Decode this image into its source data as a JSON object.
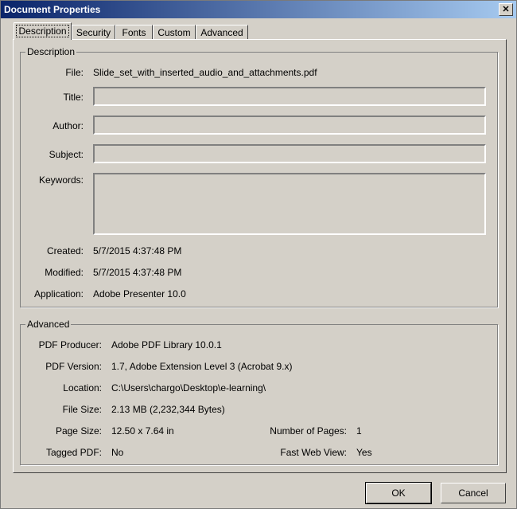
{
  "window": {
    "title": "Document Properties",
    "close_glyph": "✕"
  },
  "tabs": [
    {
      "label": "Description"
    },
    {
      "label": "Security"
    },
    {
      "label": "Fonts"
    },
    {
      "label": "Custom"
    },
    {
      "label": "Advanced"
    }
  ],
  "description": {
    "group_title": "Description",
    "file_label": "File:",
    "file_value": "Slide_set_with_inserted_audio_and_attachments.pdf",
    "title_label": "Title:",
    "title_value": "",
    "author_label": "Author:",
    "author_value": "",
    "subject_label": "Subject:",
    "subject_value": "",
    "keywords_label": "Keywords:",
    "keywords_value": "",
    "created_label": "Created:",
    "created_value": "5/7/2015 4:37:48 PM",
    "modified_label": "Modified:",
    "modified_value": "5/7/2015 4:37:48 PM",
    "application_label": "Application:",
    "application_value": "Adobe Presenter 10.0"
  },
  "advanced": {
    "group_title": "Advanced",
    "producer_label": "PDF Producer:",
    "producer_value": "Adobe PDF Library 10.0.1",
    "version_label": "PDF Version:",
    "version_value": "1.7, Adobe Extension Level 3 (Acrobat 9.x)",
    "location_label": "Location:",
    "location_value": "C:\\Users\\chargo\\Desktop\\e-learning\\",
    "filesize_label": "File Size:",
    "filesize_value": "2.13 MB (2,232,344 Bytes)",
    "pagesize_label": "Page Size:",
    "pagesize_value": "12.50 x 7.64 in",
    "numpages_label": "Number of Pages:",
    "numpages_value": "1",
    "tagged_label": "Tagged PDF:",
    "tagged_value": "No",
    "fastweb_label": "Fast Web View:",
    "fastweb_value": "Yes"
  },
  "buttons": {
    "ok": "OK",
    "cancel": "Cancel"
  }
}
